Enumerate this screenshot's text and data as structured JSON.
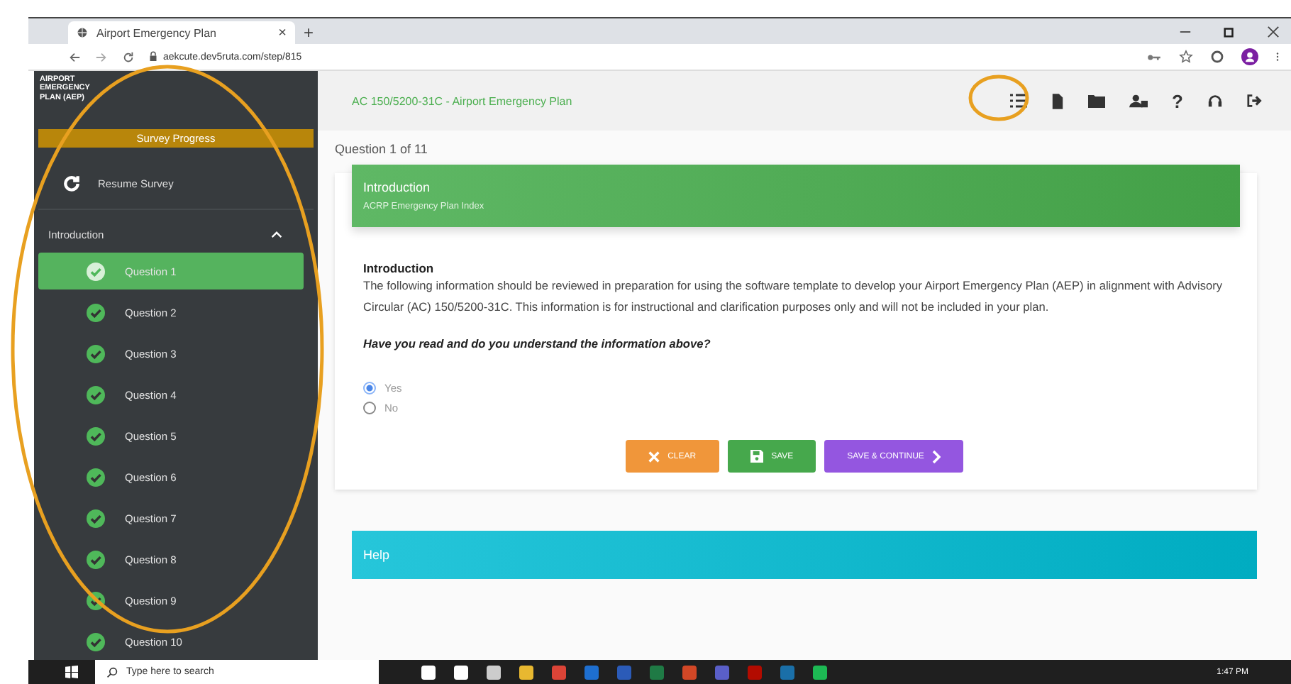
{
  "browser": {
    "tab_title": "Airport Emergency Plan",
    "tab_close": "×",
    "new_tab": "+",
    "url": "aekcute.dev5ruta.com/step/815"
  },
  "sidebar": {
    "logo": "AIRPORT EMERGENCY PLAN (AEP)",
    "survey_progress": {
      "label": "Survey Progress",
      "level": 1
    },
    "resume": "Resume Survey",
    "section": {
      "label": "Introduction",
      "expanded": true
    },
    "items": [
      {
        "label": "Question 1",
        "selected": true,
        "done": true
      },
      {
        "label": "Question 2",
        "selected": false,
        "done": true
      },
      {
        "label": "Question 3",
        "selected": false,
        "done": true
      },
      {
        "label": "Question 4",
        "selected": false,
        "done": true
      },
      {
        "label": "Question 5",
        "selected": false,
        "done": true
      },
      {
        "label": "Question 6",
        "selected": false,
        "done": true
      },
      {
        "label": "Question 7",
        "selected": false,
        "done": true
      },
      {
        "label": "Question 8",
        "selected": false,
        "done": true
      },
      {
        "label": "Question 9",
        "selected": false,
        "done": true
      },
      {
        "label": "Question 10",
        "selected": false,
        "done": true
      }
    ]
  },
  "header": {
    "title": "AC 150/5200-31C - Airport Emergency Plan",
    "help": "?"
  },
  "counter": "Question 1 of 11",
  "card": {
    "title": "Introduction",
    "subtitle": "ACRP Emergency Plan Index",
    "heading": "Introduction",
    "body": "The following information should be reviewed in preparation for using the software template to develop your Airport Emergency Plan (AEP) in alignment with Advisory Circular (AC) 150/5200-31C. This information is for instructional and clarification purposes only and will not be included in your plan.",
    "question": "Have you read and do you understand the information above?",
    "options": [
      {
        "label": "Yes",
        "selected": true
      },
      {
        "label": "No",
        "selected": false
      }
    ],
    "buttons": [
      {
        "kind": "clear",
        "label": "CLEAR"
      },
      {
        "kind": "save",
        "label": "SAVE"
      },
      {
        "kind": "continue",
        "label": "SAVE & CONTINUE"
      }
    ]
  },
  "help": {
    "title": "Help"
  },
  "taskbar": {
    "search_placeholder": "Type here to search",
    "time": "1:47 PM"
  }
}
